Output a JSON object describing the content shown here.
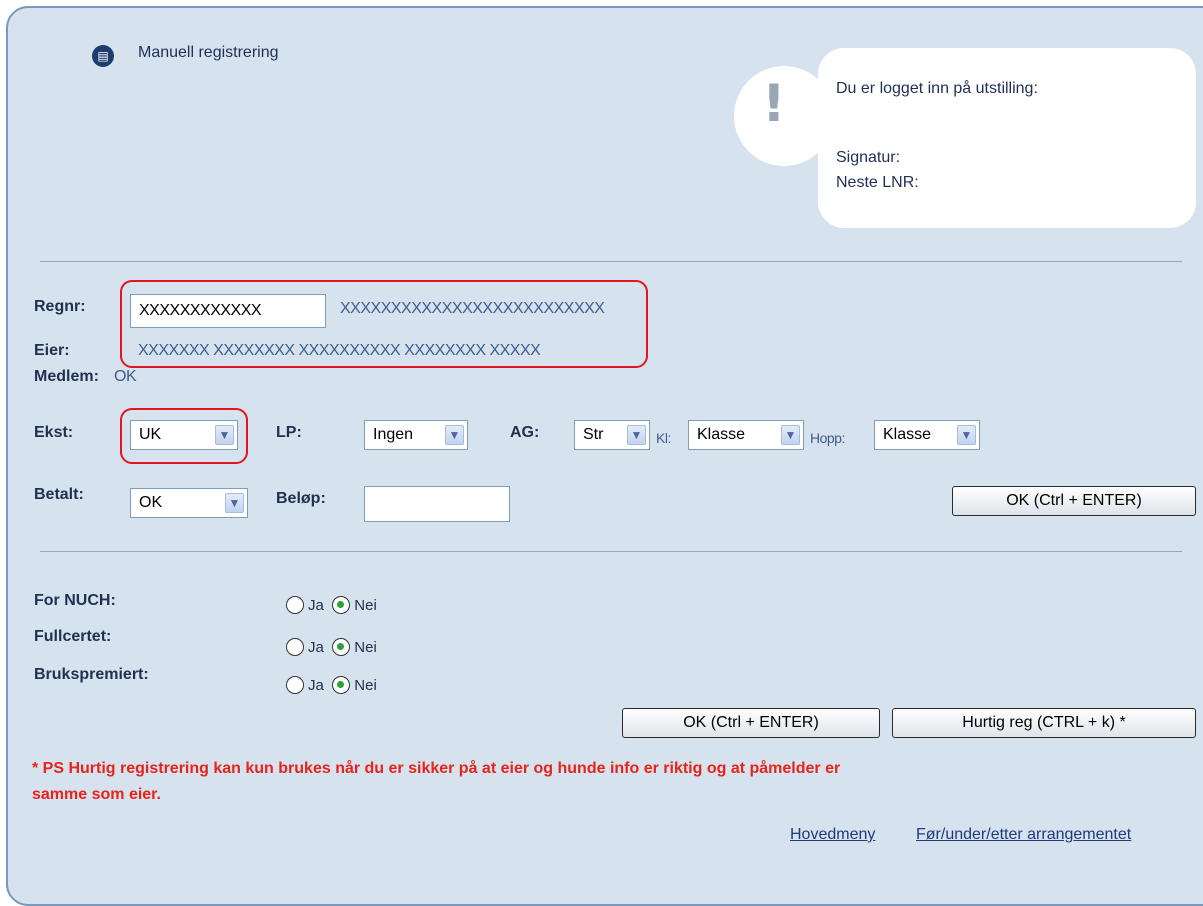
{
  "header": {
    "icon": "document-list-icon",
    "title": "Manuell registrering"
  },
  "info_bubble": {
    "icon": "exclamation-icon",
    "logged_in": "Du er logget inn på utstilling:",
    "signatur": "Signatur:",
    "neste_lnr": "Neste LNR:"
  },
  "form": {
    "regnr_label": "Regnr:",
    "regnr_value": "XXXXXXXXXXXX",
    "regnr_name": "XXXXXXXXXXXXXXXXXXXXXXXXXX",
    "eier_label": "Eier:",
    "eier_value": "XXXXXXX XXXXXXXX XXXXXXXXXX XXXXXXXX XXXXX",
    "medlem_label": "Medlem:",
    "medlem_value": "OK",
    "ekst_label": "Ekst:",
    "ekst_value": "UK",
    "lp_label": "LP:",
    "lp_value": "Ingen",
    "ag_label": "AG:",
    "ag_value": "Str",
    "kl_label": "Kl:",
    "kl_value": "Klasse",
    "hopp_label": "Hopp:",
    "hopp_value": "Klasse",
    "betalt_label": "Betalt:",
    "betalt_value": "OK",
    "belop_label": "Beløp:",
    "belop_value": "",
    "ok_button": "OK (Ctrl + ENTER)"
  },
  "options": {
    "rows": [
      {
        "label": "For NUCH:",
        "ja": "Ja",
        "nei": "Nei",
        "selected": "Nei"
      },
      {
        "label": "Fullcertet:",
        "ja": "Ja",
        "nei": "Nei",
        "selected": "Nei"
      },
      {
        "label": "Brukspremiert:",
        "ja": "Ja",
        "nei": "Nei",
        "selected": "Nei"
      }
    ],
    "ok_button": "OK (Ctrl + ENTER)",
    "quick_button": "Hurtig reg (CTRL + k) *"
  },
  "warning": {
    "line1": "* PS Hurtig registrering kan kun brukes når du er sikker på at eier og hunde info er riktig og at påmelder er",
    "line2": "samme som eier."
  },
  "links": {
    "main_menu": "Hovedmeny",
    "event": "Før/under/etter arrangementet"
  },
  "colors": {
    "panel_bg": "#d6e2ee",
    "highlight": "#e0161e",
    "warning": "#e8231a"
  }
}
